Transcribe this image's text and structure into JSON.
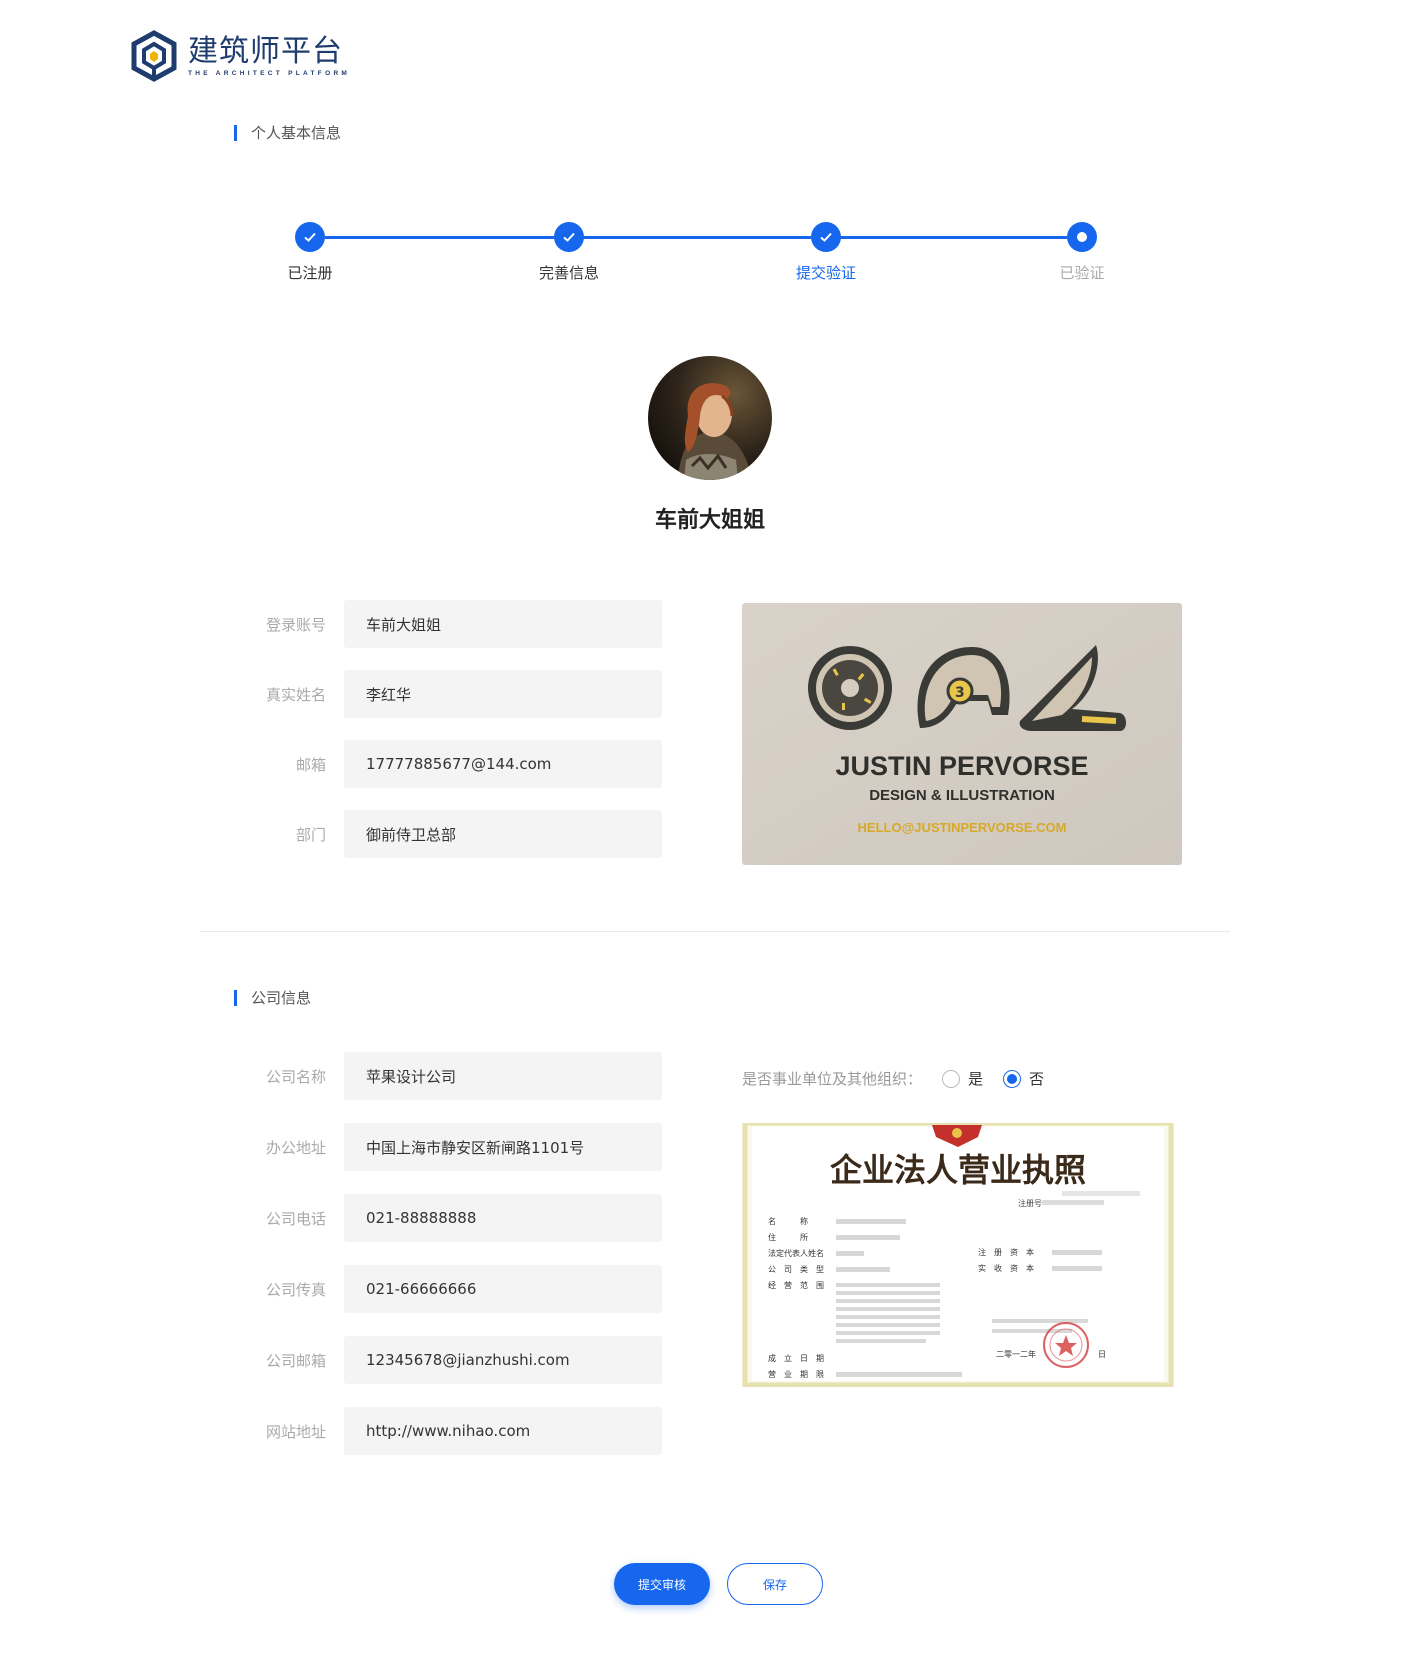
{
  "logo": {
    "title": "建筑师平台",
    "subtitle": "THE ARCHITECT PLATFORM"
  },
  "personal_section": {
    "title": "个人基本信息"
  },
  "steps": [
    {
      "label": "已注册",
      "state": "done"
    },
    {
      "label": "完善信息",
      "state": "done"
    },
    {
      "label": "提交验证",
      "state": "active"
    },
    {
      "label": "已验证",
      "state": "pending"
    }
  ],
  "profile": {
    "name": "车前大姐姐"
  },
  "personal_fields": [
    {
      "label": "登录账号",
      "value": "车前大姐姐"
    },
    {
      "label": "真实姓名",
      "value": "李红华"
    },
    {
      "label": "邮箱",
      "value": "17777885677@144.com"
    },
    {
      "label": "部门",
      "value": "御前侍卫总部"
    }
  ],
  "business_card": {
    "name": "JUSTIN PERVORSE",
    "tagline": "DESIGN & ILLUSTRATION",
    "email": "HELLO@JUSTINPERVORSE.COM"
  },
  "company_section": {
    "title": "公司信息"
  },
  "company_fields": [
    {
      "label": "公司名称",
      "value": "苹果设计公司"
    },
    {
      "label": "办公地址",
      "value": "中国上海市静安区新闸路1101号"
    },
    {
      "label": "公司电话",
      "value": "021-88888888"
    },
    {
      "label": "公司传真",
      "value": "021-66666666"
    },
    {
      "label": "公司邮箱",
      "value": "12345678@jianzhushi.com"
    },
    {
      "label": "网站地址",
      "value": "http://www.nihao.com"
    }
  ],
  "org_question": {
    "label": "是否事业单位及其他组织：",
    "options": [
      {
        "label": "是",
        "checked": false
      },
      {
        "label": "否",
        "checked": true
      }
    ]
  },
  "license": {
    "title": "企业法人营业执照",
    "reg_no_label": "注册号",
    "rows_left": [
      "名　　　称",
      "住　　　所",
      "法定代表人姓名",
      "公　司　类　型",
      "经　营　范　围"
    ],
    "rows_right": [
      "注　册　资　本",
      "实　收　资　本"
    ],
    "date_rows": [
      "成　立　日　期",
      "营　业　期　限"
    ],
    "issue_date_text": "二零一二年",
    "day_text": "日"
  },
  "buttons": {
    "submit": "提交审核",
    "save": "保存"
  },
  "colors": {
    "accent": "#1666ee",
    "input_bg": "#f4f4f4",
    "label": "#aaaaaa"
  }
}
